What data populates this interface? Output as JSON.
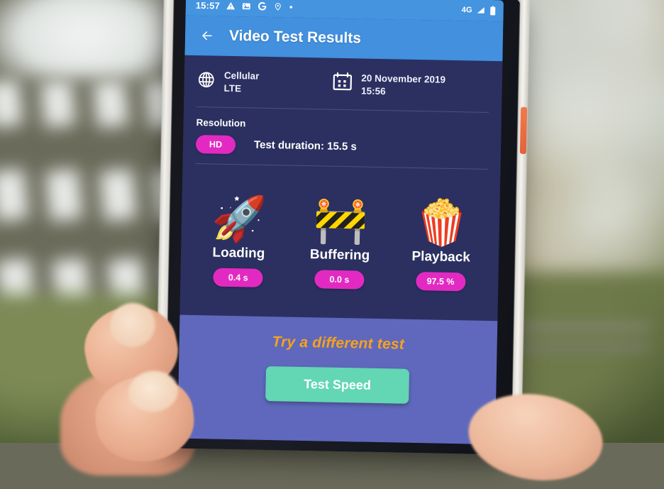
{
  "status_bar": {
    "time": "15:57",
    "left_icons": [
      "warning-triangle-icon",
      "photo-icon",
      "google-g-icon",
      "location-pin-icon",
      "dot-icon"
    ],
    "network_label": "4G",
    "right_icons": [
      "signal-bars-icon",
      "battery-icon"
    ]
  },
  "app_bar": {
    "back_icon": "back-arrow-icon",
    "title": "Video Test Results"
  },
  "meta": {
    "network": {
      "icon": "globe-icon",
      "line1": "Cellular",
      "line2": "LTE"
    },
    "datetime": {
      "icon": "calendar-icon",
      "line1": "20 November 2019",
      "line2": "15:56"
    }
  },
  "resolution": {
    "label": "Resolution",
    "badge": "HD",
    "duration": "Test duration: 15.5 s"
  },
  "metrics": [
    {
      "icon": "rocket-icon",
      "glyph": "🚀",
      "label": "Loading",
      "value": "0.4 s"
    },
    {
      "icon": "construction-barrier-icon",
      "glyph": "🚧",
      "label": "Buffering",
      "value": "0.0 s"
    },
    {
      "icon": "popcorn-icon",
      "glyph": "🍿",
      "label": "Playback",
      "value": "97.5 %"
    }
  ],
  "cta": {
    "title": "Try a different test",
    "button": "Test Speed"
  },
  "colors": {
    "app_bar_blue": "#4290de",
    "status_bar_blue": "#4494e0",
    "screen_navy": "#2b3060",
    "footer_purple": "#5f68bc",
    "pill_pink": "#e22ac2",
    "cta_orange": "#f6a21e",
    "cta_button_green": "#63d6b3",
    "power_button_orange": "#f07a4a"
  }
}
